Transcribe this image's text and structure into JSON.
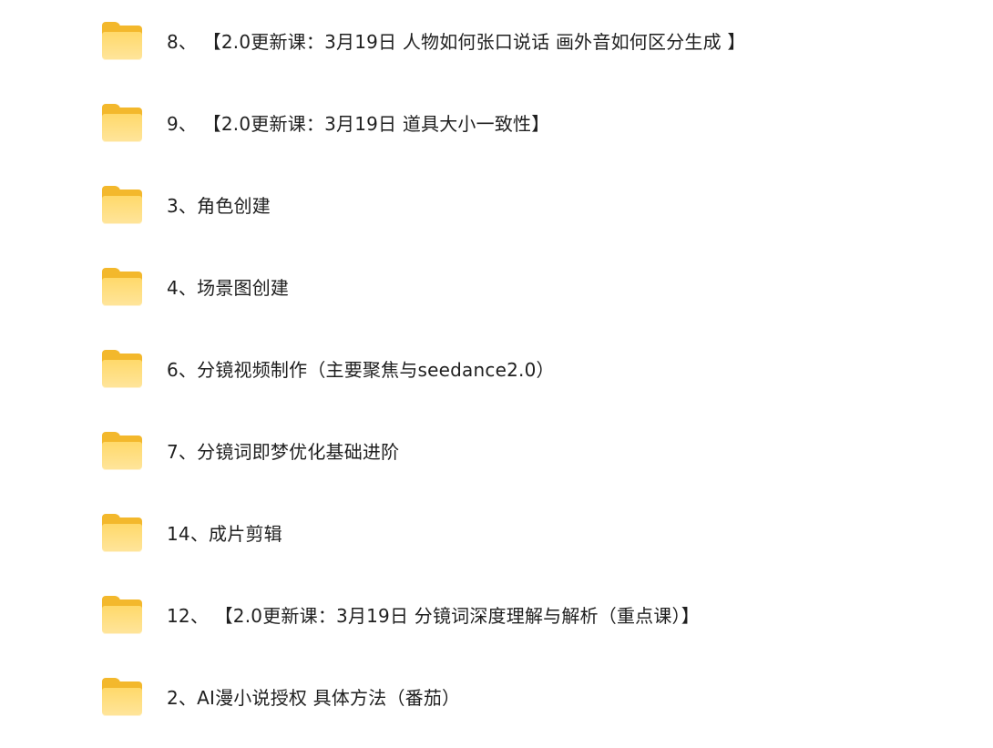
{
  "folders": [
    {
      "label": "8、 【2.0更新课：3月19日 人物如何张口说话 画外音如何区分生成 】",
      "icon": "folder-icon"
    },
    {
      "label": "9、 【2.0更新课：3月19日 道具大小一致性】",
      "icon": "folder-icon"
    },
    {
      "label": "3、角色创建",
      "icon": "folder-icon"
    },
    {
      "label": "4、场景图创建",
      "icon": "folder-icon"
    },
    {
      "label": "6、分镜视频制作（主要聚焦与seedance2.0）",
      "icon": "folder-icon"
    },
    {
      "label": "7、分镜词即梦优化基础进阶",
      "icon": "folder-icon"
    },
    {
      "label": "14、成片剪辑",
      "icon": "folder-icon"
    },
    {
      "label": "12、 【2.0更新课：3月19日 分镜词深度理解与解析（重点课）】",
      "icon": "folder-icon"
    },
    {
      "label": "2、AI漫小说授权 具体方法（番茄）",
      "icon": "folder-icon"
    }
  ],
  "colors": {
    "folder_back": "#f3b82c",
    "folder_front": "#ffd96a",
    "text": "#1f1f1f",
    "background": "#ffffff"
  }
}
